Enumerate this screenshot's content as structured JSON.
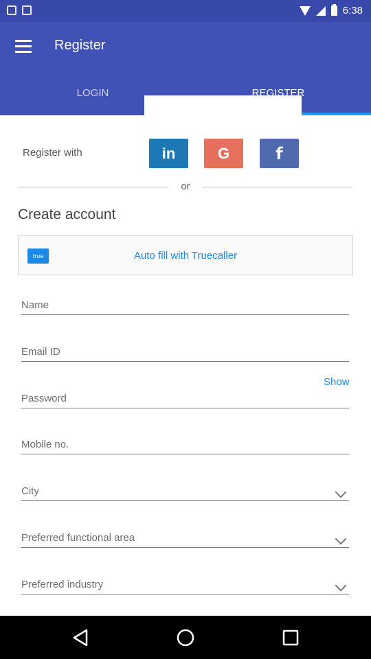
{
  "status_bar": {
    "time": "6:38"
  },
  "app_bar": {
    "title": "Register",
    "menu_icon": "hamburger-menu-icon"
  },
  "tabs": [
    {
      "label": "LOGIN",
      "selected": false
    },
    {
      "label": "REGISTER",
      "selected": true
    }
  ],
  "social": {
    "label": "Register with",
    "buttons": [
      {
        "name": "linkedin",
        "glyph": "in",
        "color": "#1e78b4"
      },
      {
        "name": "google",
        "glyph": "G",
        "color": "#e5705d"
      },
      {
        "name": "facebook",
        "glyph": "f",
        "color": "#4f6aad"
      }
    ]
  },
  "divider": {
    "text": "or"
  },
  "create_account": {
    "heading": "Create account"
  },
  "truecaller": {
    "logo_text": "true",
    "label": "Auto fill with Truecaller"
  },
  "form": {
    "name_placeholder": "Name",
    "email_placeholder": "Email ID",
    "password_placeholder": "Password",
    "password_show": "Show",
    "mobile_placeholder": "Mobile no.",
    "city_placeholder": "City",
    "functional_area_placeholder": "Preferred functional area",
    "industry_placeholder": "Preferred industry"
  },
  "colors": {
    "primary": "#3f51b5",
    "status_bar": "#3949ab",
    "accent": "#2196f3",
    "link": "#1e88e5"
  }
}
